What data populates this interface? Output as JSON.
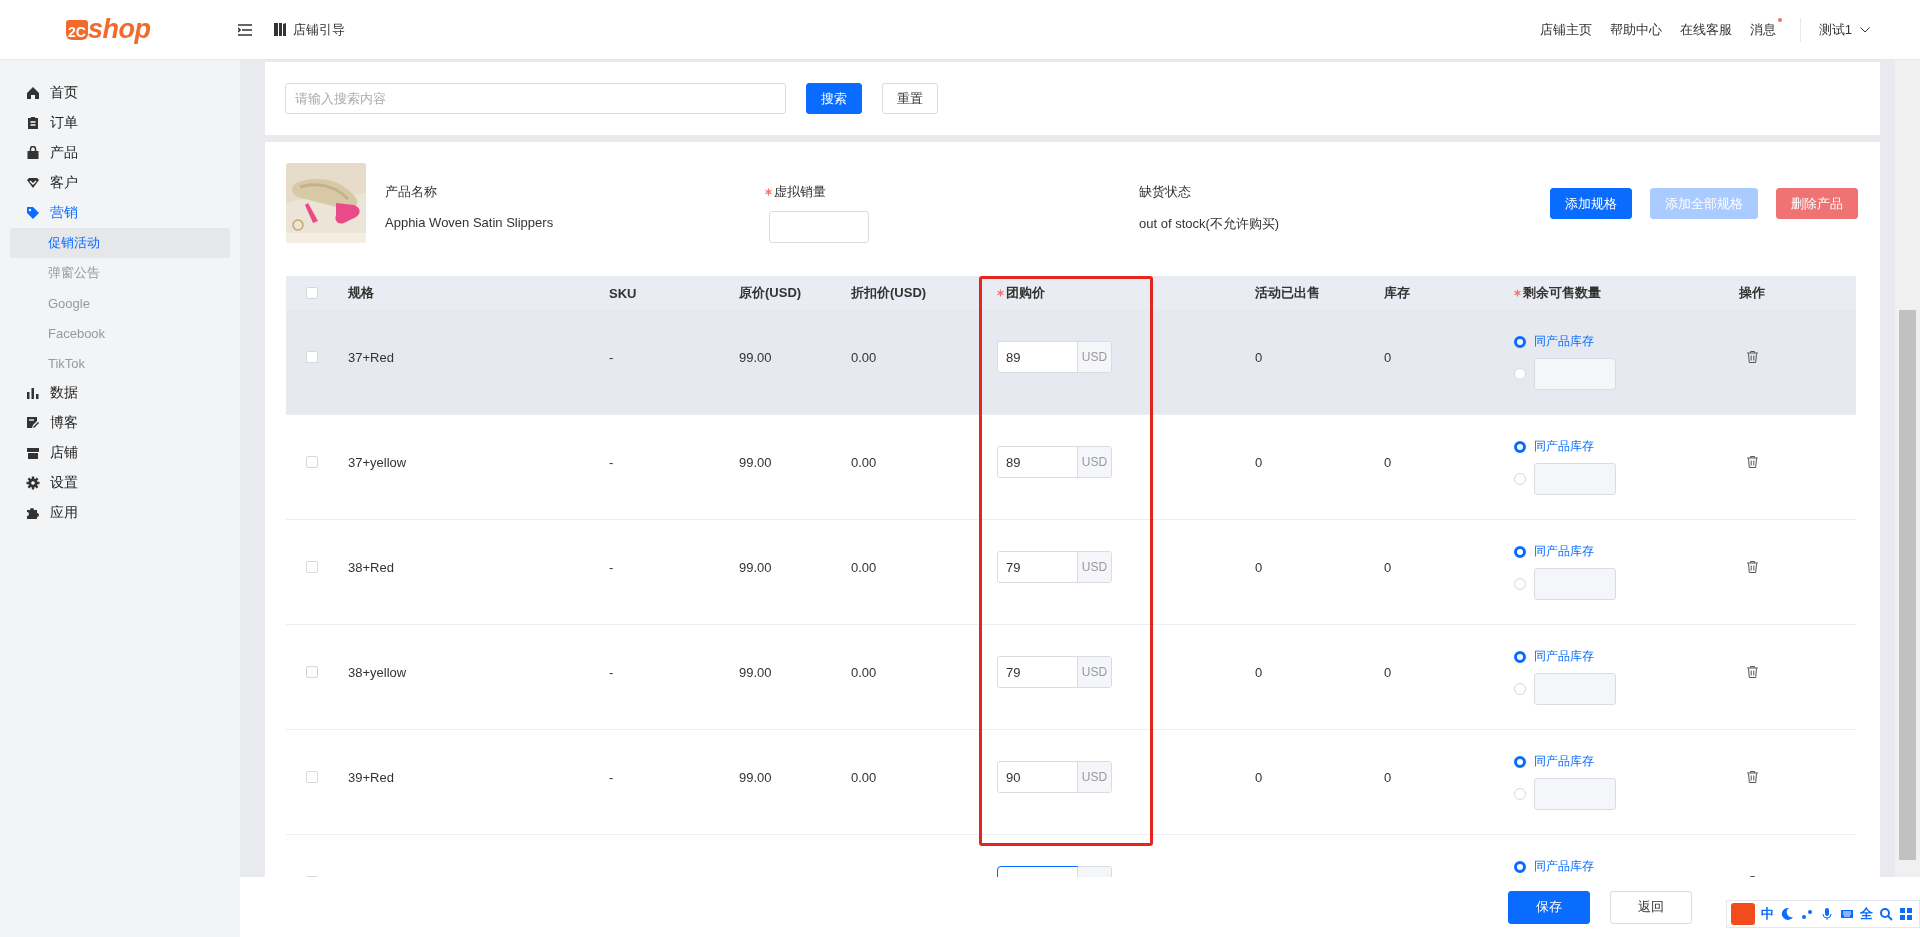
{
  "header": {
    "logo_mark": "2C",
    "logo_text": "shop",
    "guide": "店铺引导",
    "links": [
      {
        "label": "店铺主页",
        "unread": false
      },
      {
        "label": "帮助中心",
        "unread": false
      },
      {
        "label": "在线客服",
        "unread": false
      },
      {
        "label": "消息",
        "unread": true
      }
    ],
    "user": "测试1"
  },
  "sidebar": {
    "items": [
      {
        "label": "首页",
        "selected": false
      },
      {
        "label": "订单",
        "selected": false
      },
      {
        "label": "产品",
        "selected": false
      },
      {
        "label": "客户",
        "selected": false
      },
      {
        "label": "营销",
        "selected": true,
        "children": [
          {
            "label": "促销活动",
            "selected": true
          },
          {
            "label": "弹窗公告",
            "selected": false
          },
          {
            "label": "Google",
            "selected": false
          },
          {
            "label": "Facebook",
            "selected": false
          },
          {
            "label": "TikTok",
            "selected": false
          }
        ]
      },
      {
        "label": "数据",
        "selected": false
      },
      {
        "label": "博客",
        "selected": false
      },
      {
        "label": "店铺",
        "selected": false
      },
      {
        "label": "设置",
        "selected": false
      },
      {
        "label": "应用",
        "selected": false
      }
    ]
  },
  "search": {
    "placeholder": "请输入搜索内容",
    "buttons": [
      {
        "label": "搜索",
        "kind": "primary"
      },
      {
        "label": "重置",
        "kind": "default"
      }
    ]
  },
  "product": {
    "name_label": "产品名称",
    "name": "Apphia Woven Satin Slippers",
    "sales_label": "虚拟销量",
    "sales_required": true,
    "stock_label": "缺货状态",
    "stock_status": "out of stock(不允许购买)",
    "buttons": [
      {
        "label": "添加规格",
        "kind": "primary",
        "disabled": false
      },
      {
        "label": "添加全部规格",
        "kind": "primary",
        "disabled": true
      },
      {
        "label": "删除产品",
        "kind": "danger",
        "disabled": false
      }
    ]
  },
  "table": {
    "select_all": false,
    "columns": [
      {
        "label": "规格",
        "required": false,
        "highlighted": false
      },
      {
        "label": "SKU",
        "required": false,
        "highlighted": false
      },
      {
        "label": "原价(USD)",
        "required": false,
        "highlighted": false
      },
      {
        "label": "折扣价(USD)",
        "required": false,
        "highlighted": false
      },
      {
        "label": "团购价",
        "required": true,
        "highlighted": true
      },
      {
        "label": "活动已出售",
        "required": false,
        "highlighted": false
      },
      {
        "label": "库存",
        "required": false,
        "highlighted": false
      },
      {
        "label": "剩余可售数量",
        "required": true,
        "highlighted": false
      },
      {
        "label": "操作",
        "required": false,
        "highlighted": false
      }
    ],
    "rows": [
      {
        "spec": "37+Red",
        "sku": "-",
        "price": "99.00",
        "discount": "0.00",
        "group_price": "89",
        "currency": "USD",
        "sold": "0",
        "stock": "0",
        "same_stock_label": "同产品库存",
        "same_stock": true,
        "checked": false,
        "hovered": true,
        "focused": false
      },
      {
        "spec": "37+yellow",
        "sku": "-",
        "price": "99.00",
        "discount": "0.00",
        "group_price": "89",
        "currency": "USD",
        "sold": "0",
        "stock": "0",
        "same_stock_label": "同产品库存",
        "same_stock": true,
        "checked": false,
        "hovered": false,
        "focused": false
      },
      {
        "spec": "38+Red",
        "sku": "-",
        "price": "99.00",
        "discount": "0.00",
        "group_price": "79",
        "currency": "USD",
        "sold": "0",
        "stock": "0",
        "same_stock_label": "同产品库存",
        "same_stock": true,
        "checked": false,
        "hovered": false,
        "focused": false
      },
      {
        "spec": "38+yellow",
        "sku": "-",
        "price": "99.00",
        "discount": "0.00",
        "group_price": "79",
        "currency": "USD",
        "sold": "0",
        "stock": "0",
        "same_stock_label": "同产品库存",
        "same_stock": true,
        "checked": false,
        "hovered": false,
        "focused": false
      },
      {
        "spec": "39+Red",
        "sku": "-",
        "price": "99.00",
        "discount": "0.00",
        "group_price": "90",
        "currency": "USD",
        "sold": "0",
        "stock": "0",
        "same_stock_label": "同产品库存",
        "same_stock": true,
        "checked": false,
        "hovered": false,
        "focused": false
      },
      {
        "same_stock_label": "同产品库存",
        "same_stock": true,
        "checked": false,
        "hovered": false,
        "focused": true
      }
    ]
  },
  "footer": {
    "buttons": [
      {
        "label": "保存",
        "kind": "primary"
      },
      {
        "label": "返回",
        "kind": "default"
      }
    ]
  },
  "ime": {
    "items": [
      "中",
      "全"
    ]
  }
}
